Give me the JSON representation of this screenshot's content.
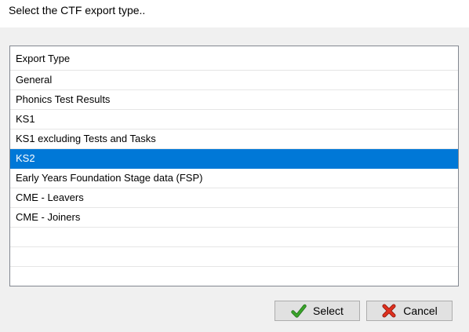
{
  "dialog": {
    "title": "Select the CTF export type.."
  },
  "list": {
    "header": "Export Type",
    "items": [
      "General",
      "Phonics Test Results",
      "KS1",
      "KS1 excluding Tests and Tasks",
      "KS2",
      "Early Years Foundation Stage data (FSP)",
      "CME - Leavers",
      "CME - Joiners"
    ],
    "selected_index": 4,
    "selected_value": "KS2"
  },
  "buttons": {
    "select_label": "Select",
    "select_icon": "checkmark-icon",
    "cancel_label": "Cancel",
    "cancel_icon": "cross-icon"
  },
  "colors": {
    "selection": "#0078d7",
    "check": "#3aa42a",
    "cross": "#e0301e"
  }
}
